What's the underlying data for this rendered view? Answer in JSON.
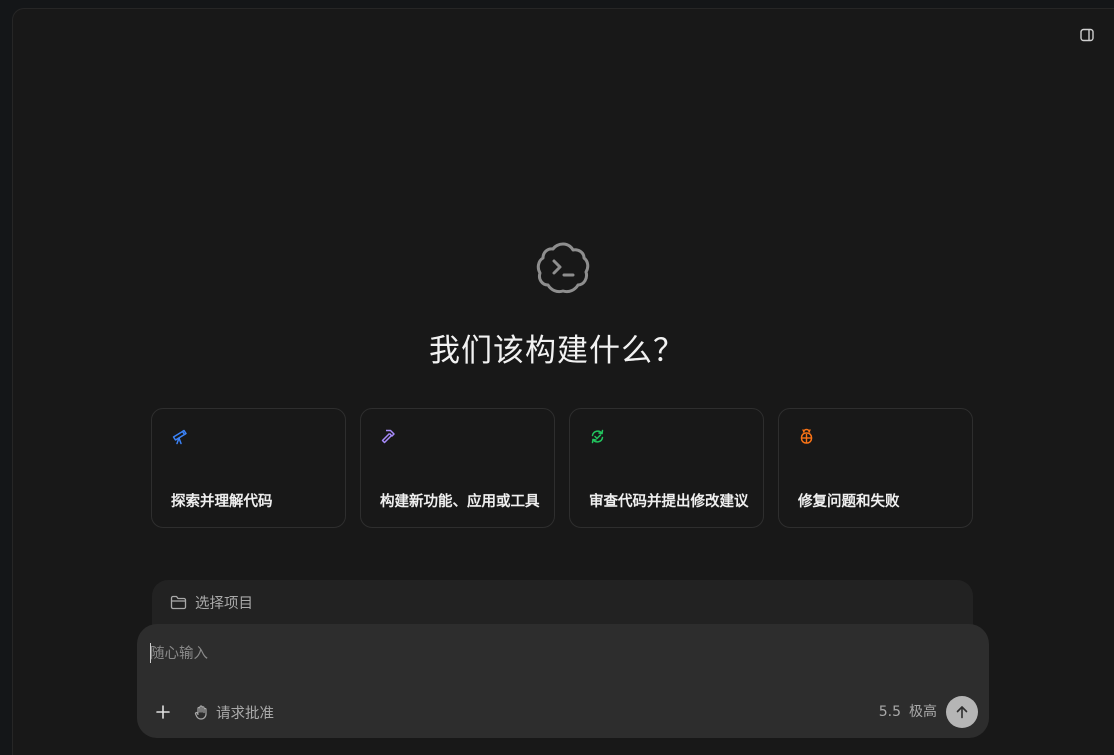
{
  "headline": "我们该构建什么？",
  "suggestions": [
    {
      "label": "探索并理解代码",
      "icon": "telescope-icon",
      "color": "#3b82f6"
    },
    {
      "label": "构建新功能、应用或工具",
      "icon": "hammer-icon",
      "color": "#a78bfa"
    },
    {
      "label": "审查代码并提出修改建议",
      "icon": "review-cycle-icon",
      "color": "#22c55e"
    },
    {
      "label": "修复问题和失败",
      "icon": "bug-icon",
      "color": "#f97316"
    }
  ],
  "project": {
    "label": "选择项目"
  },
  "composer": {
    "placeholder": "随心输入",
    "approval_label": "请求批准",
    "model": "5.5",
    "effort": "极高"
  }
}
